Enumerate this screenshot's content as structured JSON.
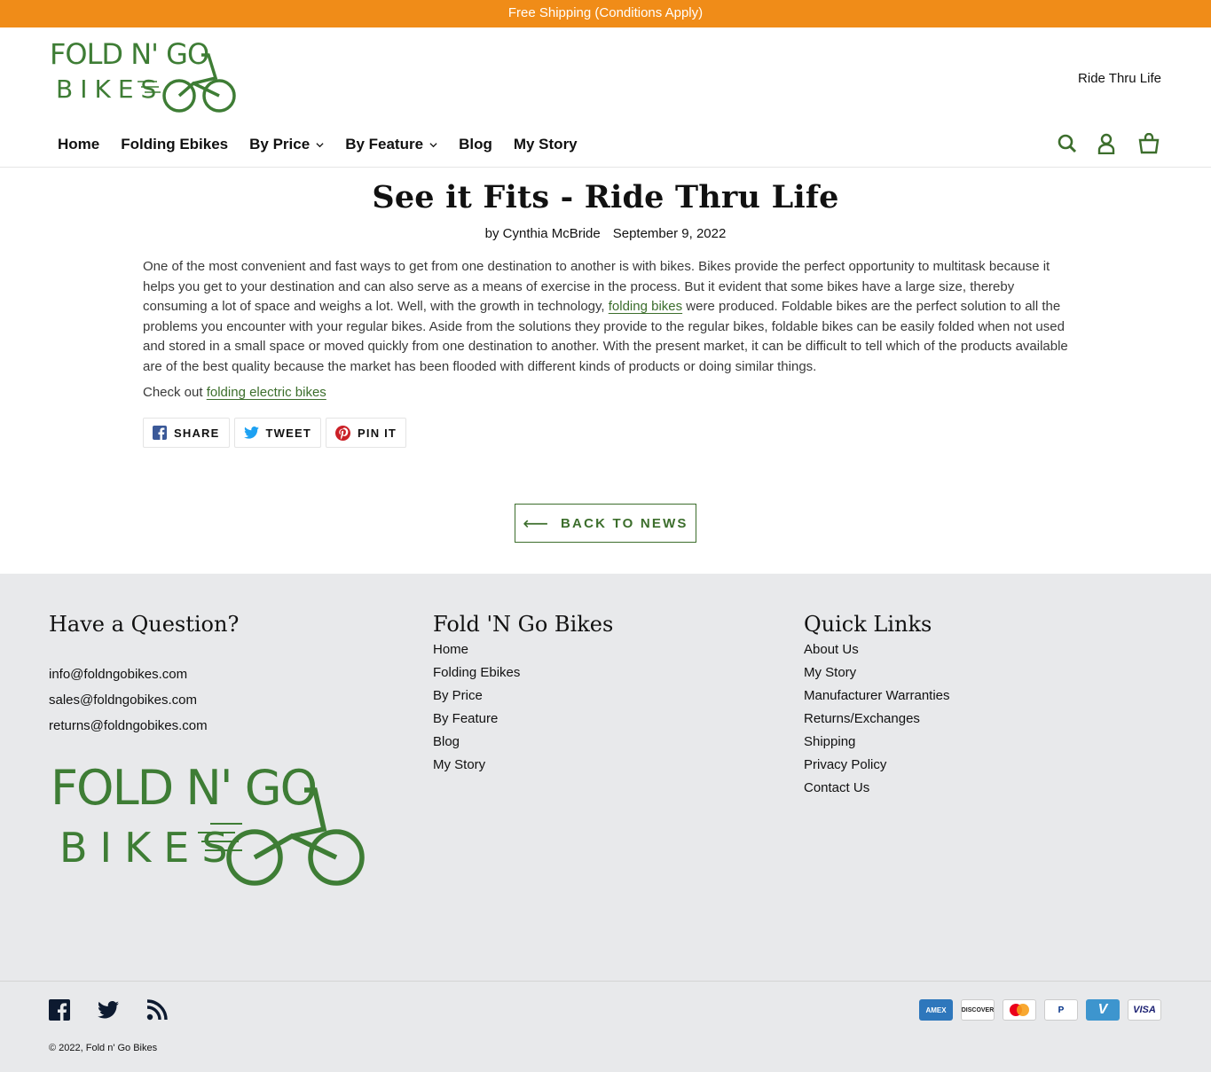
{
  "announcement": "Free Shipping (Conditions Apply)",
  "logo": {
    "line1": "FOLD N' GO",
    "line2": "BIKES"
  },
  "header": {
    "tagline": "Ride Thru Life",
    "nav": [
      {
        "label": "Home",
        "dropdown": false
      },
      {
        "label": "Folding Ebikes",
        "dropdown": false
      },
      {
        "label": "By Price",
        "dropdown": true
      },
      {
        "label": "By Feature",
        "dropdown": true
      },
      {
        "label": "Blog",
        "dropdown": false
      },
      {
        "label": "My Story",
        "dropdown": false
      }
    ],
    "icons": [
      "search-icon",
      "account-icon",
      "cart-icon"
    ]
  },
  "article": {
    "title": "See it Fits - Ride Thru Life",
    "author": "by Cynthia McBride",
    "date": "September 9, 2022",
    "body_before_link": "One of the most convenient and fast ways to get from one destination to another is with bikes. Bikes provide the perfect opportunity to multitask because it helps you get to your destination and can also serve as a means of exercise in the process. But it evident that some bikes have a large size, thereby consuming a lot of space and weighs a lot. Well, with the growth in technology, ",
    "body_link": "folding bikes",
    "body_after_link": " were produced. Foldable bikes are the perfect solution to all the problems you encounter with your regular bikes. Aside from the solutions they provide to the regular bikes, foldable bikes can be easily folded when not used and stored in a small space or moved quickly from one destination to another. With the present market, it can be difficult to tell which of the products available are of the best quality because the market has been flooded with different kinds of products or doing similar things.",
    "check_prefix": "Check out ",
    "check_link": "folding electric bikes"
  },
  "share": {
    "facebook": "SHARE",
    "twitter": "TWEET",
    "pinterest": "PIN IT"
  },
  "back_button": {
    "arrow": "⟵",
    "label": "BACK TO NEWS"
  },
  "footer": {
    "col1": {
      "heading": "Have a Question?",
      "emails": [
        "info@foldngobikes.com",
        "sales@foldngobikes.com",
        "returns@foldngobikes.com"
      ]
    },
    "col2": {
      "heading": "Fold 'N Go Bikes",
      "links": [
        "Home",
        "Folding Ebikes",
        "By Price",
        "By Feature",
        "Blog",
        "My Story"
      ]
    },
    "col3": {
      "heading": "Quick Links",
      "links": [
        "About Us",
        "My Story",
        "Manufacturer Warranties",
        "Returns/Exchanges",
        "Shipping",
        "Privacy Policy",
        "Contact Us"
      ]
    },
    "social_icons": [
      "facebook-icon",
      "twitter-icon",
      "rss-icon"
    ],
    "copyright_prefix": "© 2022, ",
    "copyright_link": "Fold n' Go Bikes",
    "payments": [
      {
        "name": "AMEX",
        "color": "#2e77bc"
      },
      {
        "name": "DISCOVER",
        "color": "#ffffff"
      },
      {
        "name": "mastercard",
        "color": "#ffffff"
      },
      {
        "name": "PayPal",
        "color": "#ffffff"
      },
      {
        "name": "V",
        "color": "#3d95ce"
      },
      {
        "name": "VISA",
        "color": "#ffffff"
      }
    ]
  },
  "colors": {
    "brand_green": "#3c6e2c",
    "announcement_orange": "#f08c18",
    "footer_bg": "#e8e9eb"
  }
}
